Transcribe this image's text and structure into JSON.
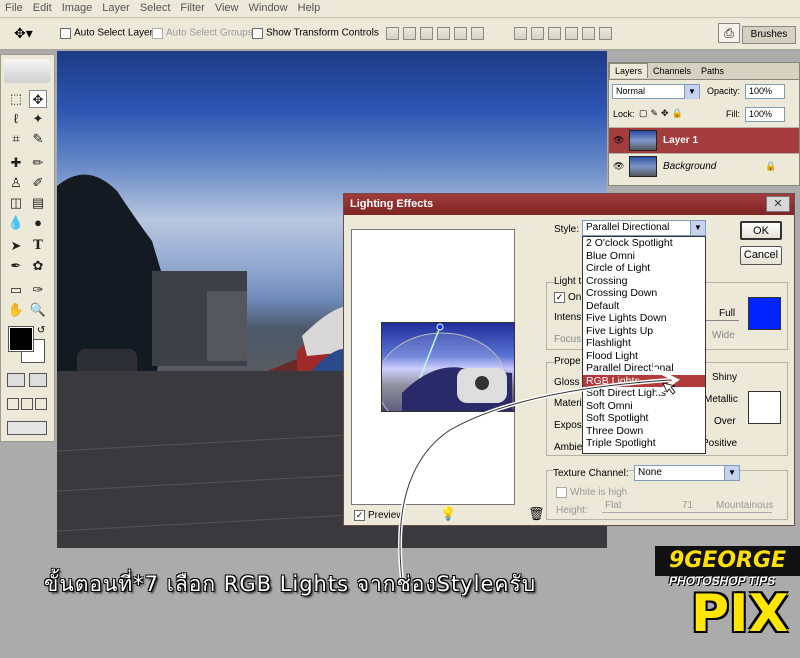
{
  "menu": [
    "File",
    "Edit",
    "Image",
    "Layer",
    "Select",
    "Filter",
    "View",
    "Window",
    "Help"
  ],
  "options": {
    "auto_select_layer": "Auto Select Layer",
    "auto_select_groups": "Auto Select Groups",
    "show_transform": "Show Transform Controls",
    "brushes": "Brushes"
  },
  "layers_panel": {
    "tabs": [
      "Layers",
      "Channels",
      "Paths"
    ],
    "blend_mode": "Normal",
    "opacity_label": "Opacity:",
    "opacity": "100%",
    "lock_label": "Lock:",
    "fill_label": "Fill:",
    "fill": "100%",
    "layers": [
      {
        "name": "Layer 1",
        "selected": true
      },
      {
        "name": "Background",
        "selected": false
      }
    ]
  },
  "dialog": {
    "title": "Lighting Effects",
    "ok": "OK",
    "cancel": "Cancel",
    "style_label": "Style:",
    "style_value": "Parallel Directional",
    "style_options": [
      "2 O'clock Spotlight",
      "Blue Omni",
      "Circle of Light",
      "Crossing",
      "Crossing Down",
      "Default",
      "Five Lights Down",
      "Five Lights Up",
      "Flashlight",
      "Flood Light",
      "Parallel Directional",
      "RGB Lights",
      "Soft Direct Lights",
      "Soft Omni",
      "Soft Spotlight",
      "Three Down",
      "Triple Spotlight"
    ],
    "selected_option": "RGB Lights",
    "light_type_label": "Light t",
    "on_label": "On",
    "intensity_label": "Intens",
    "focus_label": "Focus",
    "full_label": "Full",
    "wide_label": "Wide",
    "properties_label": "Prope",
    "gloss_label": "Gloss",
    "shiny_label": "Shiny",
    "material_label": "Materi",
    "metallic_label": "Metallic",
    "exposure_label": "Expos",
    "over_label": "Over",
    "ambience_label": "Ambien",
    "positive_label": "Positive",
    "texture_label": "Texture Channel:",
    "texture_value": "None",
    "white_is_high": "White is high",
    "height_label": "Height:",
    "flat_label": "Flat",
    "height_value": "71",
    "mountainous_label": "Mountainous",
    "preview_label": "Preview",
    "light_color": "#0024ff"
  },
  "caption": "ขั้นตอนที่*7 เลือก RGB Lights จากช่องStyleครับ",
  "logo": {
    "line1": "9GEORGE",
    "line2": "PHOTOSHOP TIPS",
    "line3": "PIX"
  }
}
